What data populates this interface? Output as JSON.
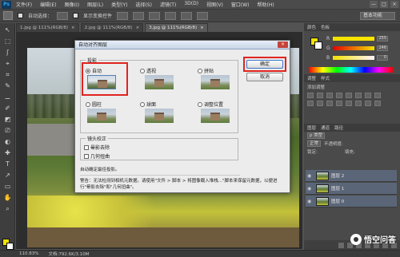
{
  "app": {
    "logo": "Ps"
  },
  "menu": [
    "文件(F)",
    "编辑(E)",
    "图像(I)",
    "图层(L)",
    "类型(Y)",
    "选择(S)",
    "滤镜(T)",
    "3D(D)",
    "视图(V)",
    "窗口(W)",
    "帮助(H)"
  ],
  "window_buttons": [
    "—",
    "□",
    "×"
  ],
  "options_bar": {
    "auto_select": "自动选择：",
    "show_transform": "显示变换控件",
    "workspace": "基本功能"
  },
  "tabs": [
    {
      "label": "1.jpg @ 111%(RGB/8)",
      "close": "×"
    },
    {
      "label": "2.jpg @ 111%(RGB/8)",
      "close": "×"
    },
    {
      "label": "3.jpg @ 111%(RGB/8)",
      "close": "×"
    }
  ],
  "toolbox": [
    "↖",
    "⬚",
    "ʃ",
    "⌖",
    "⌗",
    "✎",
    "⚊",
    "✐",
    "◩",
    "⎚",
    "◐",
    "✚",
    "T",
    "↗",
    "▭",
    "✋",
    "⌕"
  ],
  "status": {
    "zoom": "110.83%",
    "doc": "文档:792.6K/3.10M"
  },
  "panels": {
    "color_tabs": [
      "颜色",
      "色板"
    ],
    "channels": [
      {
        "label": "R",
        "value": "255",
        "color": "#e33"
      },
      {
        "label": "G",
        "value": "246",
        "color": "#3c3"
      },
      {
        "label": "B",
        "value": "0",
        "color": "#36f"
      }
    ],
    "adjust_tabs": [
      "调整",
      "样式"
    ],
    "adjust_title": "添加调整",
    "layers_tabs": [
      "图层",
      "通道",
      "路径"
    ],
    "layer_kind": "p 类型",
    "layer_mode": "正常",
    "opacity_label": "不透明度:",
    "lock_label": "锁定:",
    "fill_label": "填充:",
    "layers": [
      "图层 2",
      "图层 1",
      "图层 0"
    ]
  },
  "dialog": {
    "title": "自动对齐图层",
    "close": "×",
    "projection_label": "投影",
    "options": [
      {
        "label": "自动",
        "selected": true
      },
      {
        "label": "透视",
        "selected": false
      },
      {
        "label": "拼贴",
        "selected": false
      },
      {
        "label": "圆柱",
        "selected": false
      },
      {
        "label": "球面",
        "selected": false
      },
      {
        "label": "调整位置",
        "selected": false
      }
    ],
    "lens_label": "镜头校正",
    "lens_checks": [
      "晕影去除",
      "几何扭曲"
    ],
    "ok": "确定",
    "cancel": "取消",
    "info_title": "自动确定最佳投影。",
    "warning": "警告：无法检测到相机元数据。请使用\"文件 > 脚本 > 将图像载入堆栈...\"脚本来保留元数据，以便进行\"晕影去除\"和\"几何扭曲\"。"
  },
  "watermark": "悟空问答",
  "colors": {
    "foreground": "#f2e200",
    "background": "#ffffff",
    "highlight": "#e0231f",
    "layer_selected": "#5a6678"
  }
}
